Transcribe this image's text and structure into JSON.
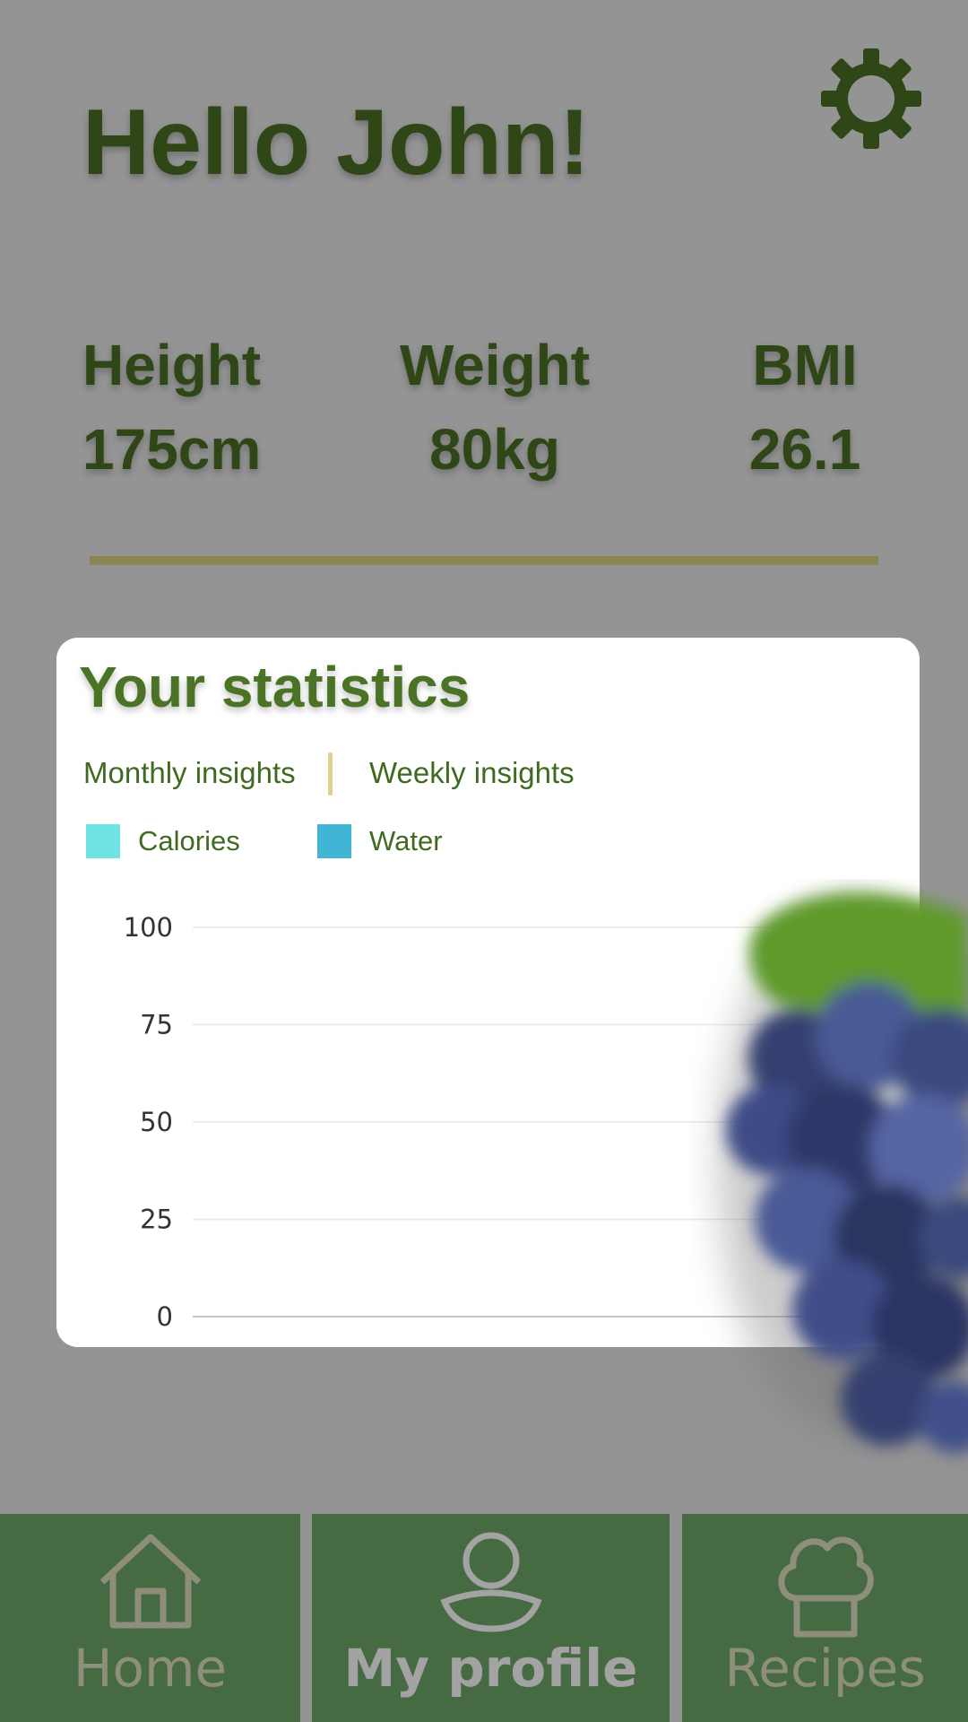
{
  "header": {
    "greeting": "Hello John!",
    "settings_icon": "gear-icon"
  },
  "metrics": {
    "height": {
      "label": "Height",
      "value": "175cm"
    },
    "weight": {
      "label": "Weight",
      "value": "80kg"
    },
    "bmi": {
      "label": "BMI",
      "value": "26.1"
    }
  },
  "statistics": {
    "title": "Your statistics",
    "tabs": [
      {
        "label": "Monthly insights"
      },
      {
        "label": "Weekly insights"
      }
    ],
    "legend": [
      {
        "label": "Calories",
        "color": "#6fe3e3"
      },
      {
        "label": "Water",
        "color": "#41b5d4"
      }
    ]
  },
  "chart_data": {
    "type": "bar",
    "categories": [],
    "series": [
      {
        "name": "Calories",
        "values": []
      },
      {
        "name": "Water",
        "values": []
      }
    ],
    "yticks": [
      "100",
      "75",
      "50",
      "25",
      "0"
    ],
    "ylim": [
      0,
      100
    ],
    "grid": true
  },
  "nav": {
    "items": [
      {
        "label": "Home",
        "icon": "home-icon"
      },
      {
        "label": "My profile",
        "icon": "user-icon",
        "active": true
      },
      {
        "label": "Recipes",
        "icon": "chef-hat-icon"
      }
    ]
  },
  "colors": {
    "background": "#949494",
    "text_dark_green": "#2f4616",
    "accent_green": "#4b7326",
    "nav_green": "#466b43",
    "divider": "#8b8453"
  }
}
